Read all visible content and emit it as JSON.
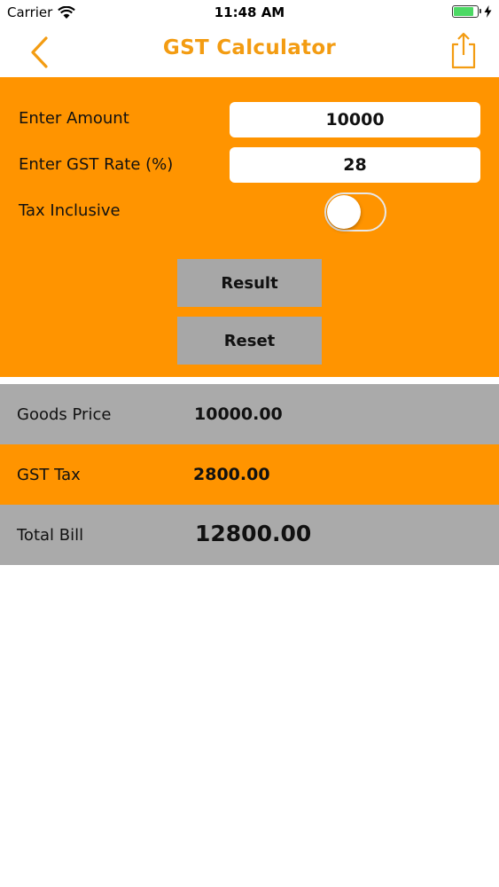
{
  "status_bar": {
    "carrier": "Carrier",
    "time": "11:48 AM"
  },
  "nav": {
    "title": "GST Calculator",
    "back_icon": "chevron-left-icon",
    "share_icon": "share-icon",
    "accent_color": "#f39c12"
  },
  "form": {
    "amount_label": "Enter Amount",
    "amount_value": "10000",
    "rate_label": "Enter GST Rate (%)",
    "rate_value": "28",
    "tax_inclusive_label": "Tax Inclusive",
    "tax_inclusive": false,
    "result_button": "Result",
    "reset_button": "Reset",
    "panel_color": "#ff9400"
  },
  "results": {
    "goods_price_label": "Goods Price",
    "goods_price_value": "10000.00",
    "gst_tax_label": "GST Tax",
    "gst_tax_value": "2800.00",
    "total_bill_label": "Total Bill",
    "total_bill_value": "12800.00",
    "gray_color": "#aaaaaa",
    "orange_color": "#ff9400"
  }
}
